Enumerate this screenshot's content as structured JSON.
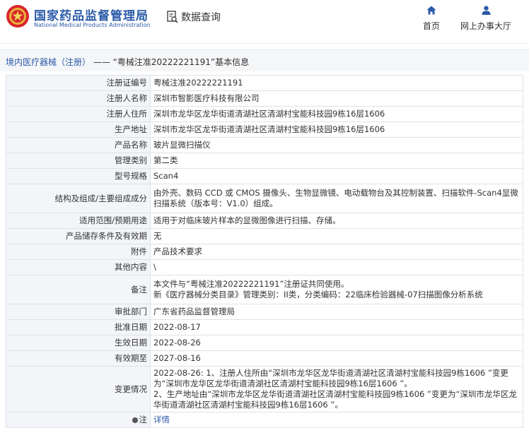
{
  "header": {
    "brand_cn": "国家药品监督管理局",
    "brand_en": "National Medical Products Administration",
    "query_label": "数据查询",
    "nav": [
      {
        "label": "首页",
        "icon": "home-icon"
      },
      {
        "label": "网上办事大厅",
        "icon": "user-icon"
      }
    ]
  },
  "title_bar": {
    "part1": "境内医疗器械（注册）",
    "sep": "——",
    "part2": "“粤械注准20222221191”基本信息"
  },
  "rows": [
    {
      "key": "注册证编号",
      "value": "粤械注准20222221191"
    },
    {
      "key": "注册人名称",
      "value": "深圳市智影医疗科技有限公司"
    },
    {
      "key": "注册人住所",
      "value": "深圳市龙华区龙华街道清湖社区清湖村宝能科技园9栋16层1606"
    },
    {
      "key": "生产地址",
      "value": "深圳市龙华区龙华街道清湖社区清湖村宝能科技园9栋16层1606"
    },
    {
      "key": "产品名称",
      "value": "玻片显微扫描仪"
    },
    {
      "key": "管理类别",
      "value": "第二类"
    },
    {
      "key": "型号规格",
      "value": "Scan4"
    },
    {
      "key": "结构及组成/主要组成成分",
      "value": "由外壳、数码 CCD 或 CMOS 摄像头、生物显微镜、电动载物台及其控制装置、扫描软件-Scan4显微扫描系统（版本号：V1.0）组成。"
    },
    {
      "key": "适用范围/预期用途",
      "value": "适用于对临床玻片样本的显微图像进行扫描、存储。"
    },
    {
      "key": "产品储存条件及有效期",
      "value": "无"
    },
    {
      "key": "附件",
      "value": "产品技术要求"
    },
    {
      "key": "其他内容",
      "value": "\\"
    },
    {
      "key": "备注",
      "lines": [
        "本文件与“粤械注准20222221191”注册证共同使用。",
        "新《医疗器械分类目录》管理类别：II类，分类编码：22临床检验器械-07扫描图像分析系统"
      ]
    },
    {
      "key": "审批部门",
      "value": "广东省药品监督管理局"
    },
    {
      "key": "批准日期",
      "value": "2022-08-17"
    },
    {
      "key": "生效日期",
      "value": "2022-08-26"
    },
    {
      "key": "有效期至",
      "value": "2027-08-16"
    },
    {
      "key": "变更情况",
      "value": "2022-08-26: 1、注册人住所由“深圳市龙华区龙华街道清湖社区清湖村宝能科技园9栋1606 ”变更为“深圳市龙华区龙华街道清湖社区清湖村宝能科技园9栋16层1606 ”。\n2、生产地址由“深圳市龙华区龙华街道清湖社区清湖村宝能科技园9栋1606 ”变更为“深圳市龙华区龙华街道清湖社区清湖村宝能科技园9栋16层1606 ”。"
    },
    {
      "key": "注",
      "value": "详情",
      "link": true
    }
  ]
}
